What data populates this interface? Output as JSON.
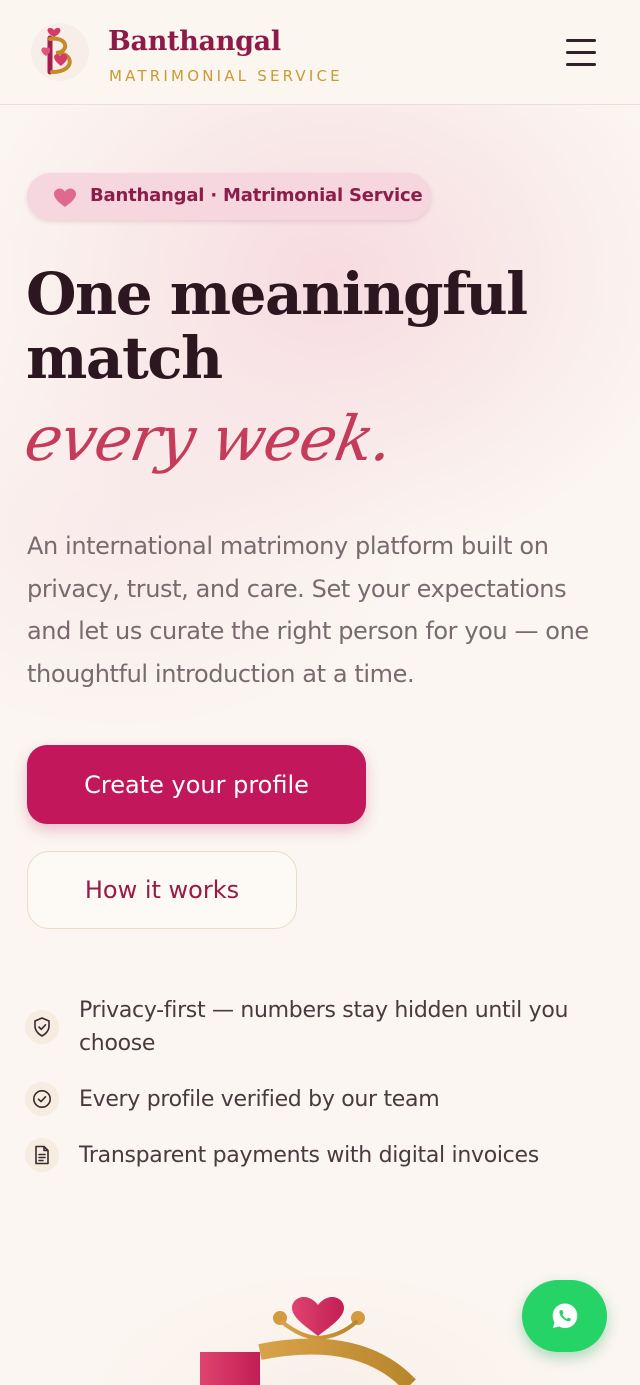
{
  "header": {
    "brand_name": "Banthangal",
    "brand_tagline": "MATRIMONIAL SERVICE",
    "logo_icon": "heart-b-monogram-icon",
    "menu_icon": "hamburger-menu-icon"
  },
  "hero": {
    "badge_text": "Banthangal · Matrimonial Service",
    "title_line1": "One meaningful",
    "title_line2": "match",
    "title_script": "every week.",
    "description": "An international matrimony platform built on privacy, trust, and care. Set your expectations and let us curate the right person for you — one thoughtful introduction at a time.",
    "primary_cta": "Create your profile",
    "secondary_cta": "How it works"
  },
  "features": [
    {
      "icon": "shield-check-icon",
      "text": "Privacy-first — numbers stay hidden until you choose"
    },
    {
      "icon": "check-circle-icon",
      "text": "Every profile verified by our team"
    },
    {
      "icon": "document-icon",
      "text": "Transparent payments with digital invoices"
    }
  ],
  "floating": {
    "whatsapp_icon": "whatsapp-icon"
  },
  "colors": {
    "brand": "#8d1a48",
    "accent_gold": "#c99a35",
    "primary_button": "#c2185b",
    "script_rose": "#c43c5a",
    "whatsapp_green": "#25d366",
    "background": "#fbf6f1"
  }
}
